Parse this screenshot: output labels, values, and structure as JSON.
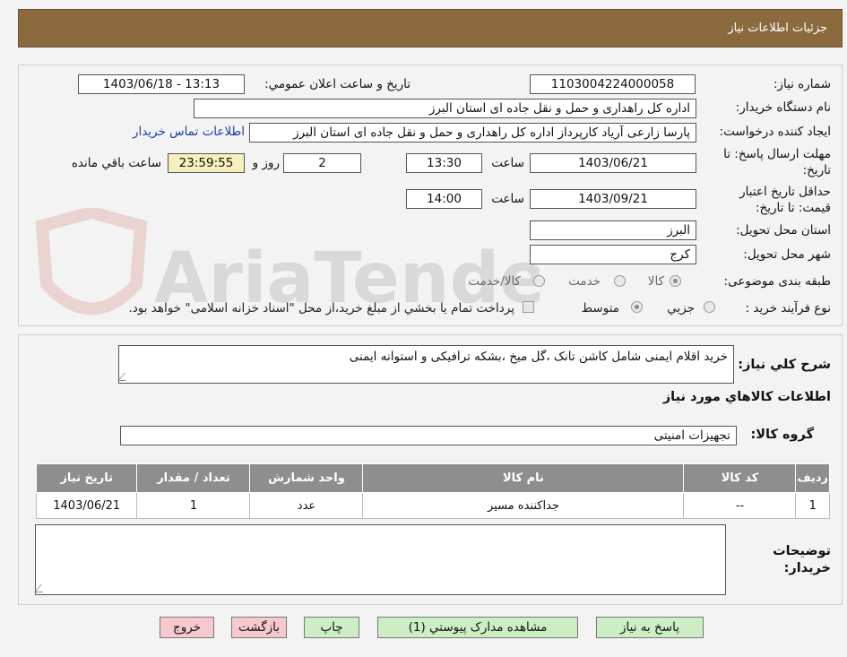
{
  "header": {
    "title": "جزئیات اطلاعات نیاز"
  },
  "fields": {
    "need_number_label": "شماره نیاز:",
    "need_number": "1103004224000058",
    "announce_label": "تاریخ و ساعت اعلان عمومي:",
    "announce_value": "1403/06/18 - 13:13",
    "buyer_org_label": "نام دستگاه خريدار:",
    "buyer_org": "اداره کل راهداری و حمل و نقل جاده ای استان البرز",
    "creator_label": "ايجاد کننده درخواست:",
    "creator": "پارسا زارعی آریاد کارپرداز اداره کل راهداری و حمل و نقل جاده ای استان البرز",
    "contact_link": "اطلاعات تماس خريدار",
    "reply_deadline_label": "مهلت ارسال پاسخ: تا تاریخ:",
    "reply_date": "1403/06/21",
    "time_label": "ساعت",
    "reply_time": "13:30",
    "days": "2",
    "days_label": "روز و",
    "remaining_time": "23:59:55",
    "remaining_label": "ساعت باقي مانده",
    "validity_label": "حداقل تاريخ اعتبار قيمت: تا تاريخ:",
    "validity_date": "1403/09/21",
    "validity_time": "14:00",
    "province_label": "استان محل تحويل:",
    "province": "البرز",
    "city_label": "شهر محل تحويل:",
    "city": "کرج",
    "category_label": "طبقه بندی موضوعی:",
    "category_options": [
      "کالا",
      "خدمت",
      "کالا/خدمت"
    ],
    "process_label": "نوع فرآيند خريد :",
    "process_options": [
      "جزيي",
      "متوسط"
    ],
    "treasury_note": "پرداخت تمام يا بخشي از مبلغ خريد،از محل \"اسناد خزانه اسلامی\" خواهد بود."
  },
  "description": {
    "label": "شرح کلي نياز:",
    "text": "خرید اقلام ایمنی شامل کاشن تانک ،گل میخ ،بشکه ترافیکی و استوانه ایمنی"
  },
  "goods_section": {
    "title": "اطلاعات کالاهاي مورد نياز",
    "group_label": "گروه کالا:",
    "group_value": "تجهیزات امنیتی"
  },
  "table": {
    "headers": [
      "رديف",
      "کد کالا",
      "نام کالا",
      "واحد شمارش",
      "تعداد / مقدار",
      "تاريخ نياز"
    ],
    "rows": [
      [
        "1",
        "--",
        "جداکننده مسیر",
        "عدد",
        "1",
        "1403/06/21"
      ]
    ]
  },
  "buyer_notes_label": "توضيحات خريدار:",
  "buttons": {
    "reply": "پاسخ به نیاز",
    "attachments": "مشاهده مدارک پيوستي (1)",
    "print": "چاپ",
    "back": "بازگشت",
    "exit": "خروج"
  },
  "watermark_text": "AriaTender.neT"
}
